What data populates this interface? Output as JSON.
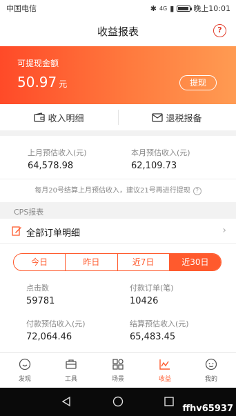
{
  "status_bar": {
    "carrier": "中国电信",
    "network": "4G",
    "time": "晚上10:01"
  },
  "header": {
    "title": "收益报表",
    "help_icon": "question-circle-icon"
  },
  "balance": {
    "label": "可提现金额",
    "amount": "50.97",
    "unit": "元",
    "withdraw_label": "提现"
  },
  "quick_links": {
    "income_detail": "收入明细",
    "tax_report": "退税报备"
  },
  "estimates": {
    "last_month_label": "上月预估收入(元)",
    "last_month_value": "64,578.98",
    "this_month_label": "本月预估收入(元)",
    "this_month_value": "62,109.73",
    "note": "每月20号结算上月预估收入，建议21号再进行提现"
  },
  "cps": {
    "section_label": "CPS报表",
    "all_orders": "全部订单明细",
    "tabs": [
      "今日",
      "昨日",
      "近7日",
      "近30日"
    ],
    "active_tab": "近30日",
    "stats": {
      "clicks_label": "点击数",
      "clicks_value": "59781",
      "paid_orders_label": "付款订单(笔)",
      "paid_orders_value": "10426",
      "paid_income_label": "付款预估收入(元)",
      "paid_income_value": "72,064.46",
      "settled_income_label": "结算预估收入(元)",
      "settled_income_value": "65,483.45"
    }
  },
  "bottom_nav": [
    {
      "label": "发现",
      "icon": "discover-icon"
    },
    {
      "label": "工具",
      "icon": "toolbox-icon"
    },
    {
      "label": "场景",
      "icon": "grid-icon"
    },
    {
      "label": "收益",
      "icon": "chart-icon",
      "active": true
    },
    {
      "label": "我的",
      "icon": "profile-icon"
    }
  ],
  "watermark": "ffhv65937",
  "colors": {
    "accent": "#ff5a2d",
    "banner_start": "#ff4a28",
    "banner_end": "#ff9b52"
  }
}
